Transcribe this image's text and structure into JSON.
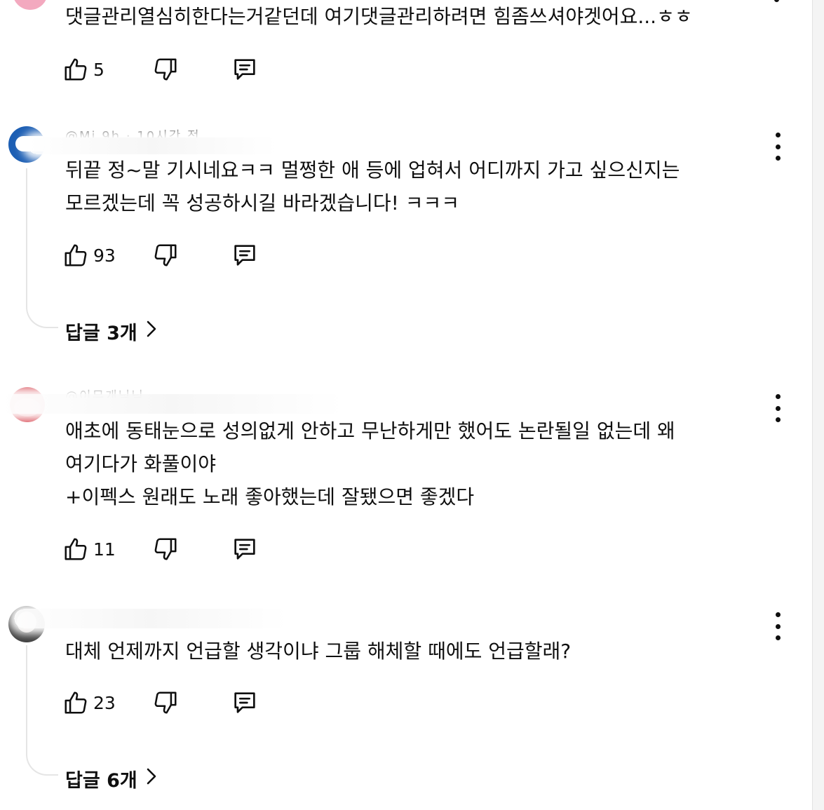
{
  "comments": [
    {
      "text": "댓글관리열심히한다는거같던데 여기댓글관리하려면 힘좀쓰셔야겟어요...ㅎㅎ",
      "like_count": "5",
      "avatar_color": "#f3a9bf"
    },
    {
      "author_fragment": "@Mi   9h · 10시간 전",
      "text": "뒤끝 정~말 기시네요ㅋㅋ 멀쩡한 애 등에 업혀서 어디까지 가고 싶으신지는\n모르겠는데 꼭 성공하시길 바라겠습니다! ㅋㅋㅋ",
      "like_count": "93",
      "replies_label": "답글 3개",
      "avatar_color": "#1d5fb4"
    },
    {
      "author_fragment": "@이무개님님",
      "text": "애초에 동태눈으로 성의없게 안하고 무난하게만 했어도 논란될일 없는데 왜\n여기다가 화풀이야\n+이펙스 원래도 노래 좋아했는데 잘됐으면 좋겠다",
      "like_count": "11",
      "avatar_color": "#d9505a"
    },
    {
      "text": "대체 언제까지 언급할 생각이냐 그룹 해체할 때에도 언급할래?",
      "like_count": "23",
      "replies_label": "답글 6개",
      "avatar_color": "#3f3f3f"
    }
  ],
  "icons": {
    "like": "thumbs-up-outline",
    "dislike": "thumbs-down-outline",
    "reply": "comment-bubble-outline",
    "more": "vertical-ellipsis",
    "replies_expand": "chevron-right"
  }
}
